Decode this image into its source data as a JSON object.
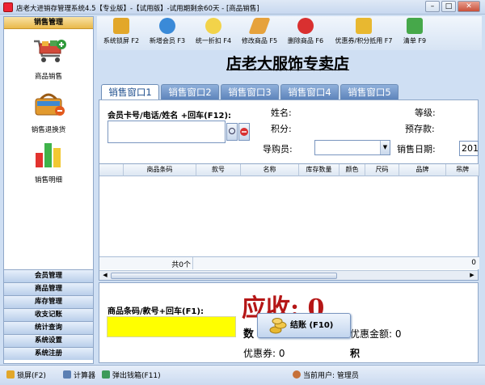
{
  "window": {
    "title": "店老大进销存管理系统4.5【专业版】-【试用版】-试用期剩余60天 - [商品销售]",
    "minimize": "–",
    "maximize": "□",
    "close": "✕"
  },
  "sidebar": {
    "header": "销售管理",
    "items": [
      {
        "label": "商品销售",
        "icon": "shopping-cart-icon"
      },
      {
        "label": "销售退换货",
        "icon": "return-basket-icon"
      },
      {
        "label": "销售明细",
        "icon": "bar-chart-icon"
      }
    ],
    "nav": [
      "会员管理",
      "商品管理",
      "库存管理",
      "收支记账",
      "统计查询",
      "系统设置",
      "系统注册"
    ]
  },
  "toolbar": [
    {
      "label": "系统锁屏 F2",
      "icon": "lock-icon",
      "color": "#e2a72a"
    },
    {
      "label": "新增会员 F3",
      "icon": "add-user-icon",
      "color": "#3a8ad8"
    },
    {
      "label": "统一折扣 F4",
      "icon": "lightbulb-icon",
      "color": "#f2d34a"
    },
    {
      "label": "修改商品 F5",
      "icon": "pencil-icon",
      "color": "#e6a23c"
    },
    {
      "label": "删除商品 F6",
      "icon": "delete-icon",
      "color": "#d93030"
    },
    {
      "label": "优惠券/积分抵用 F7",
      "icon": "coins-icon",
      "color": "#e8b830"
    },
    {
      "label": "清单 F9",
      "icon": "basket-icon",
      "color": "#46a84a"
    }
  ],
  "store_title": "店老大服饰专卖店",
  "tabs": [
    "销售窗口1",
    "销售窗口2",
    "销售窗口3",
    "销售窗口4",
    "销售窗口5"
  ],
  "member": {
    "search_label": "会员卡号/电话/姓名 +回车(F12):",
    "name_label": "姓名:",
    "level_label": "等级:",
    "points_label": "积分:",
    "prepaid_label": "预存款:",
    "guide_label": "导购员:",
    "date_label": "销售日期:",
    "date_value": "201"
  },
  "grid": {
    "columns": [
      "",
      "商品条码",
      "款号",
      "名称",
      "库存数量",
      "颜色",
      "尺码",
      "品牌",
      "吊牌"
    ],
    "footer_total": "共0个",
    "footer_sum": "0"
  },
  "checkout": {
    "barcode_label": "商品条码/款号+回车(F1):",
    "receivable_label": "应收:",
    "receivable_value": "0",
    "quantity_label": "数",
    "discount_label": "优惠金额:",
    "discount_value": "0",
    "coupon_label": "优惠券:",
    "coupon_value": "0",
    "points_partial": "积",
    "checkout_button": "结账 (F10)"
  },
  "status": {
    "lock": "锁屏(F2)",
    "calculator": "计算器",
    "cash_drawer": "弹出钱箱(F11)",
    "current_user": "当前用户: 管理员"
  },
  "colors": {
    "highlight_input": "#ffff00",
    "receivable": "#b51616",
    "tab_active_text": "#1a4b8c"
  }
}
